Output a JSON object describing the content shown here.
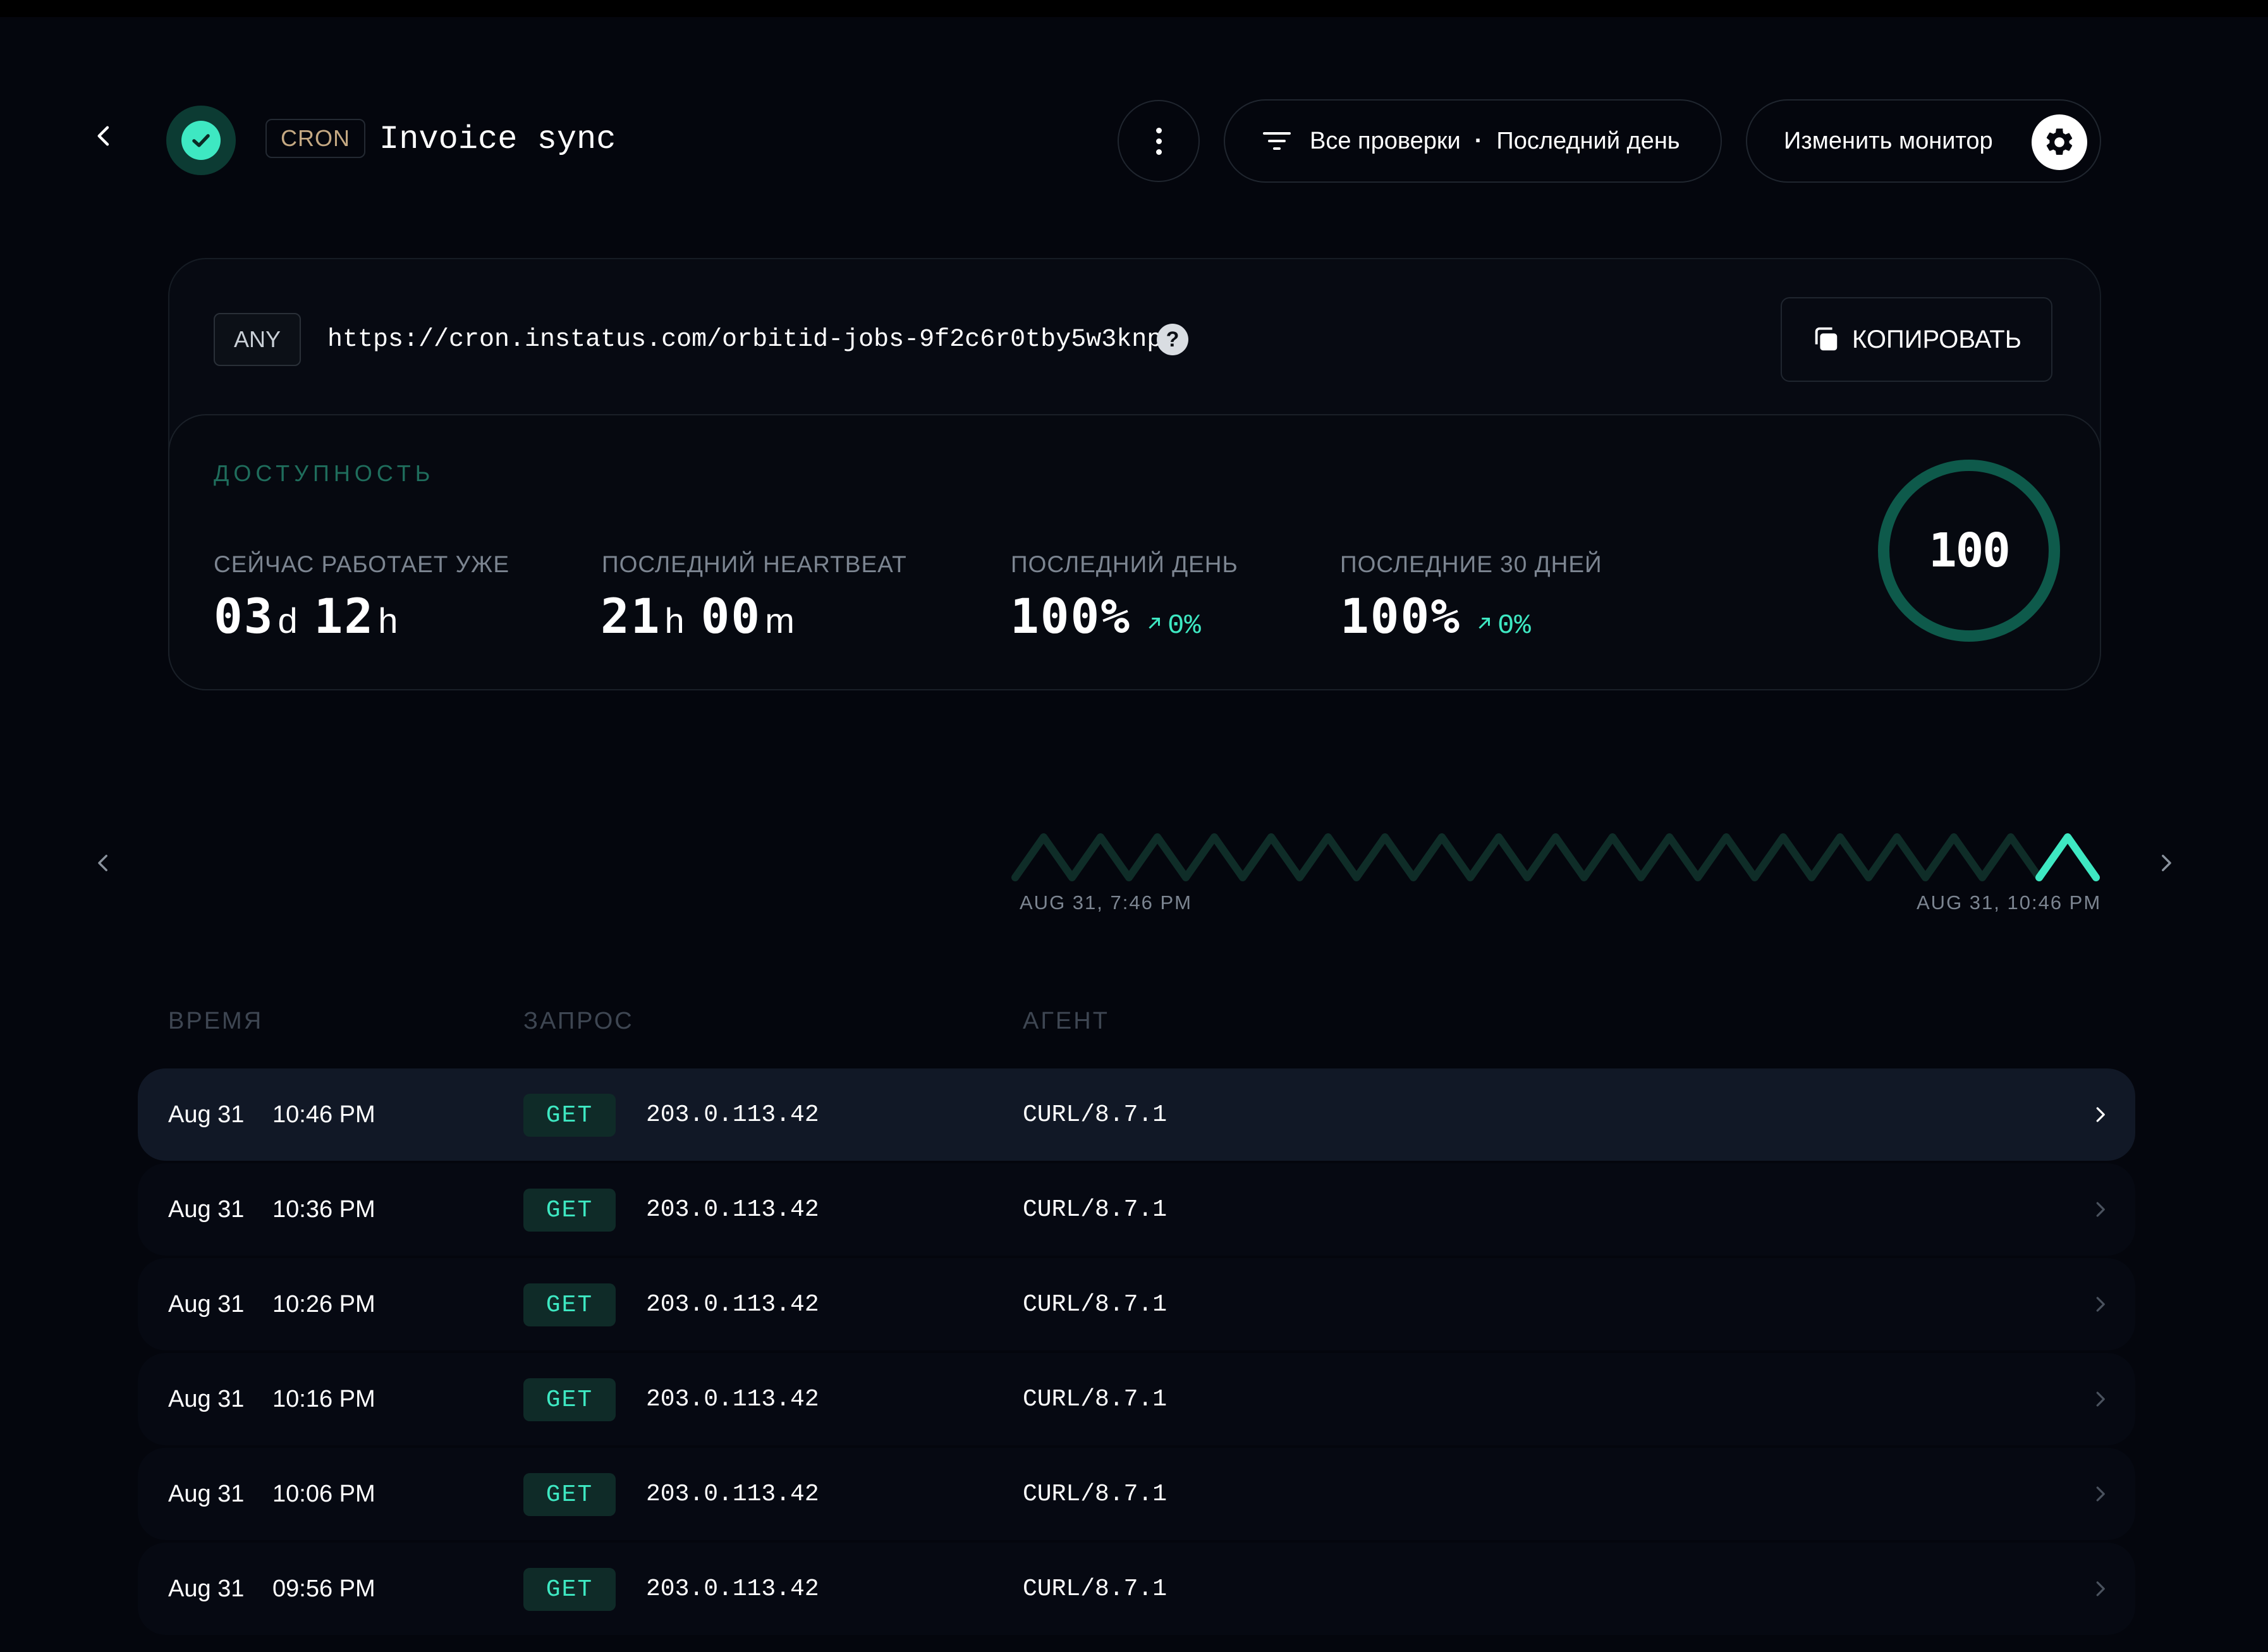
{
  "header": {
    "cron_tag": "CRON",
    "monitor_name": "Invoice sync",
    "filter_all": "Все проверки",
    "filter_separator": "·",
    "filter_period": "Последний день",
    "edit_label": "Изменить монитор"
  },
  "endpoint": {
    "method_tag": "ANY",
    "url": "https://cron.instatus.com/orbitid-jobs-9f2c6r0tby5w3knp",
    "help": "?",
    "copy_label": "КОПИРОВАТЬ"
  },
  "availability": {
    "section_label": "ДОСТУПНОСТЬ",
    "uptime": {
      "label": "СЕЙЧАС РАБОТАЕТ УЖЕ",
      "days": "03",
      "days_unit": "d",
      "hours": "12",
      "hours_unit": "h"
    },
    "heartbeat": {
      "label": "ПОСЛЕДНИЙ HEARTBEAT",
      "hours": "21",
      "hours_unit": "h",
      "minutes": "00",
      "minutes_unit": "m"
    },
    "last_day": {
      "label": "ПОСЛЕДНИЙ ДЕНЬ",
      "value": "100%",
      "delta": "0%"
    },
    "last_30": {
      "label": "ПОСЛЕДНИЕ 30 ДНЕЙ",
      "value": "100%",
      "delta": "0%"
    },
    "score": "100"
  },
  "timeline": {
    "start_label": "AUG 31, 7:46 PM",
    "end_label": "AUG 31, 10:46 PM",
    "bumps": 19
  },
  "table": {
    "headers": [
      "ВРЕМЯ",
      "ЗАПРОС",
      "АГЕНТ"
    ],
    "rows": [
      {
        "date": "Aug 31",
        "time": "10:46 PM",
        "method": "GET",
        "ip": "203.0.113.42",
        "agent": "CURL/8.7.1"
      },
      {
        "date": "Aug 31",
        "time": "10:36 PM",
        "method": "GET",
        "ip": "203.0.113.42",
        "agent": "CURL/8.7.1"
      },
      {
        "date": "Aug 31",
        "time": "10:26 PM",
        "method": "GET",
        "ip": "203.0.113.42",
        "agent": "CURL/8.7.1"
      },
      {
        "date": "Aug 31",
        "time": "10:16 PM",
        "method": "GET",
        "ip": "203.0.113.42",
        "agent": "CURL/8.7.1"
      },
      {
        "date": "Aug 31",
        "time": "10:06 PM",
        "method": "GET",
        "ip": "203.0.113.42",
        "agent": "CURL/8.7.1"
      },
      {
        "date": "Aug 31",
        "time": "09:56 PM",
        "method": "GET",
        "ip": "203.0.113.42",
        "agent": "CURL/8.7.1"
      }
    ]
  },
  "colors": {
    "accent": "#3ee8c2",
    "ring": "#0e5a4b",
    "background": "#04060d"
  }
}
